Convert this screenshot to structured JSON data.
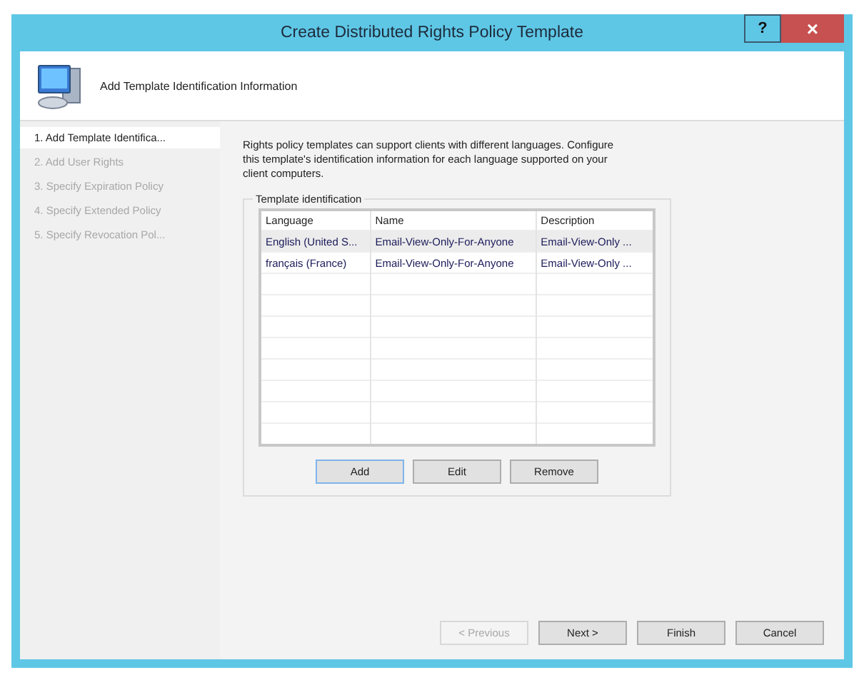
{
  "window": {
    "title": "Create Distributed Rights Policy Template",
    "help": "?",
    "close": "×"
  },
  "header": {
    "title": "Add Template Identification Information"
  },
  "steps": [
    {
      "label": "1. Add Template Identifica...",
      "selected": true,
      "disabled": false
    },
    {
      "label": "2. Add User Rights",
      "selected": false,
      "disabled": true
    },
    {
      "label": "3. Specify Expiration Policy",
      "selected": false,
      "disabled": true
    },
    {
      "label": "4. Specify Extended Policy",
      "selected": false,
      "disabled": true
    },
    {
      "label": "5. Specify Revocation Pol...",
      "selected": false,
      "disabled": true
    }
  ],
  "intro": "Rights policy templates can support clients with different languages. Configure this template's identification information for each language supported on your client computers.",
  "group": {
    "title": "Template identification",
    "table": {
      "columns": [
        "Language",
        "Name",
        "Description"
      ],
      "rows": [
        {
          "cells": [
            "English (United S...",
            "Email-View-Only-For-Anyone",
            "Email-View-Only ..."
          ],
          "selected": true
        },
        {
          "cells": [
            "français (France)",
            "Email-View-Only-For-Anyone",
            "Email-View-Only ..."
          ],
          "selected": false
        }
      ]
    },
    "buttons": [
      {
        "label": "Add",
        "focused": true
      },
      {
        "label": "Edit",
        "focused": false
      },
      {
        "label": "Remove",
        "focused": false
      }
    ]
  },
  "footer": [
    {
      "label": "< Previous",
      "disabled": true
    },
    {
      "label": "Next >",
      "disabled": false
    },
    {
      "label": "Finish",
      "disabled": false
    },
    {
      "label": "Cancel",
      "disabled": false
    }
  ]
}
